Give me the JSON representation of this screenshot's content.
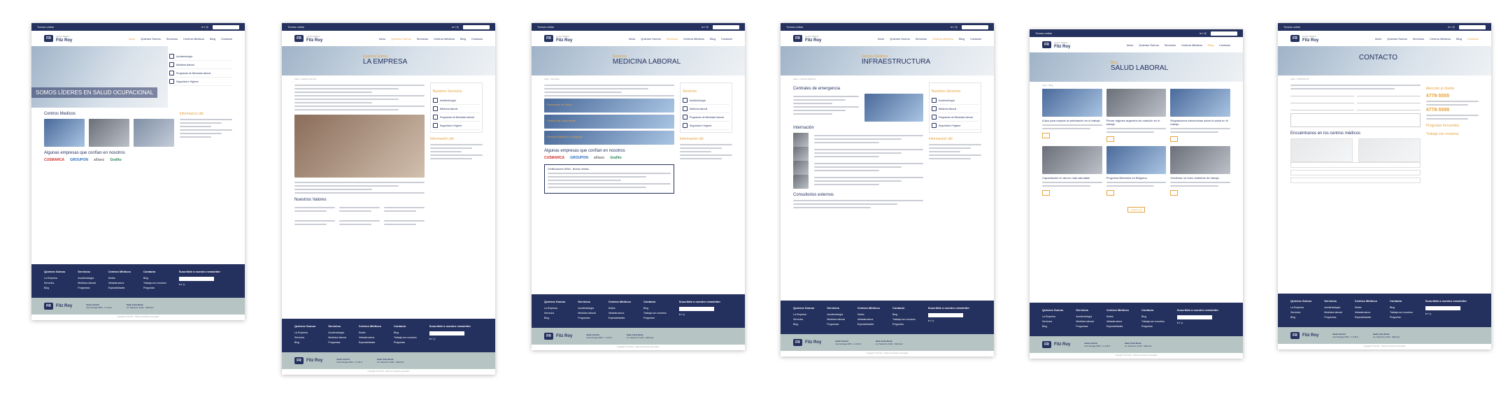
{
  "colors": {
    "navy": "#24305e",
    "accent": "#e8a33b",
    "footer_gray": "#b6c4c4"
  },
  "site": {
    "brand_small": "Centro Médico",
    "brand": "Fitz Roy",
    "logo_mark": "FR",
    "topbar_left": "Turnos online",
    "topbar_social": "in f ◎",
    "nav": [
      "Inicio",
      "Quienes Somos",
      "Servicios",
      "Centros Médicos",
      "Blog",
      "Contacto"
    ]
  },
  "pages": [
    {
      "id": "home",
      "hero_text": "SOMOS LÍDERES EN SALUD OCUPACIONAL",
      "services": [
        "Accidentología",
        "Medicina laboral",
        "Programas de Bienestar laboral",
        "Seguridad e Higiene"
      ],
      "section_title": "Centros Medicos",
      "side_title": "Informacion útil",
      "logos_title": "Algunas empresas que confían en nosotros",
      "logos": [
        "CUSMARCA",
        "GROUPON",
        "allianz",
        "Grafito"
      ]
    },
    {
      "id": "empresa",
      "hero_pre": "Quienes Somos",
      "hero_title": "LA EMPRESA",
      "side_title": "Nuestros Servicios",
      "section_title": "Nuestros Valores",
      "side_title2": "Información útil"
    },
    {
      "id": "medicina",
      "hero_pre": "Servicios",
      "hero_title": "MEDICINA LABORAL",
      "services": [
        "Exámenes de Salud",
        "Gestión de Ausentismo",
        "Servicio Médico in Company"
      ],
      "logos_title": "Algunas empresas que confían en nosotros",
      "logos": [
        "CUSMARCA",
        "GROUPON",
        "allianz",
        "Grafito"
      ],
      "cert_title": "Certificaciones IRAM - Bureau Veritas",
      "side_title": "Información útil"
    },
    {
      "id": "infra",
      "hero_pre": "Centros Médicos",
      "hero_title": "INFRAESTRUCTURA",
      "section_title": "Centrales de emergencia",
      "section_title2": "Internación",
      "section_title3": "Consultorios externos",
      "side_title": "Nuestros Servicios",
      "side_title2": "Información útil"
    },
    {
      "id": "blog",
      "hero_pre": "Blog",
      "hero_title": "SALUD LABORAL",
      "posts": [
        "A tipo para mejorar la celebración en el trabajo",
        "Primer régimen argentino de nutrición en el trabajo",
        "Regulaciones electrónicas sobre la salud en el trabajo",
        "Capacitación en ahorro más saludable",
        "Programa Bienestar en Belgrano",
        "Gestionar un buen ambiente de trabajo"
      ],
      "more": "Cargar más"
    },
    {
      "id": "contacto",
      "hero_title": "CONTACTO",
      "phone1": "4778-5555",
      "phone2": "4778-5599",
      "side_title": "Atención al cliente",
      "section_title": "Encuéntranos en los centros médicos",
      "faq_title": "Preguntas frecuentes",
      "faq_title2": "Trabaja con nosotros"
    }
  ],
  "footer": {
    "cols": [
      {
        "title": "Quienes Somos",
        "items": [
          "La Empresa",
          "Servicios",
          "Blog"
        ]
      },
      {
        "title": "Servicios",
        "items": [
          "Accidentología",
          "Medicina laboral",
          "Programas"
        ]
      },
      {
        "title": "Centros Médicos",
        "items": [
          "Sedes",
          "Infraestructura",
          "Especialidades"
        ]
      },
      {
        "title": "Contacto",
        "items": [
          "Blog",
          "Trabaja con nosotros",
          "Preguntas"
        ]
      }
    ],
    "newsletter": "Suscribite a nuestro newsletter",
    "sede_central": "Sede Central",
    "sede_central_addr": "Gurruchaga 2463 - C.A.B.A.",
    "sede_norte": "Sede Zona Norte",
    "sede_norte_addr": "Av. Santa Fe 1234 - Martinez",
    "copyright": "Copyright © Fitz Roy - Todos los derechos reservados"
  }
}
